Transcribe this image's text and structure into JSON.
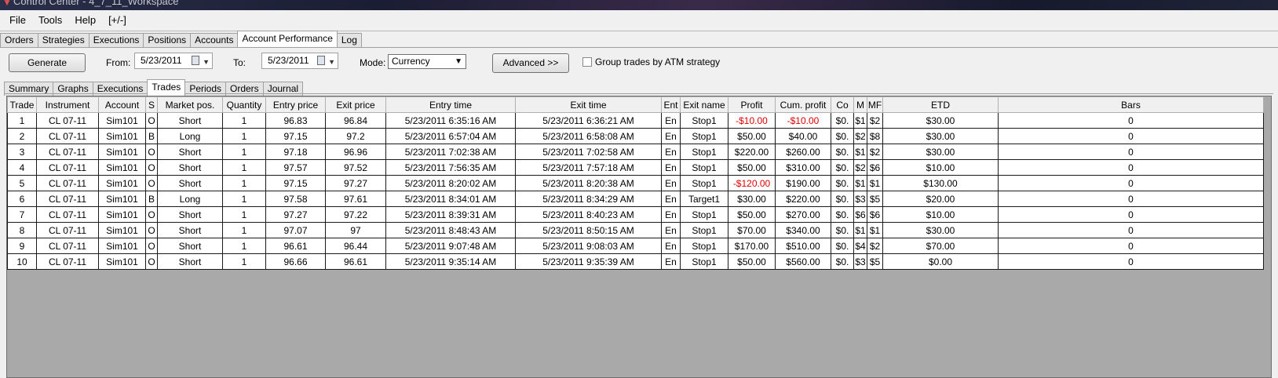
{
  "window": {
    "title": "Control Center - 4_7_11_Workspace"
  },
  "menu": [
    "File",
    "Tools",
    "Help",
    "[+/-]"
  ],
  "top_tabs": [
    {
      "label": "Orders",
      "active": false
    },
    {
      "label": "Strategies",
      "active": false
    },
    {
      "label": "Executions",
      "active": false
    },
    {
      "label": "Positions",
      "active": false
    },
    {
      "label": "Accounts",
      "active": false
    },
    {
      "label": "Account Performance",
      "active": true
    },
    {
      "label": "Log",
      "active": false
    }
  ],
  "toolbar": {
    "generate_label": "Generate",
    "from_label": "From:",
    "from_value": "5/23/2011",
    "to_label": "To:",
    "to_value": "5/23/2011",
    "mode_label": "Mode:",
    "mode_value": "Currency",
    "advanced_label": "Advanced >>",
    "group_label": "Group trades by ATM strategy"
  },
  "inner_tabs": [
    {
      "label": "Summary",
      "active": false
    },
    {
      "label": "Graphs",
      "active": false
    },
    {
      "label": "Executions",
      "active": false
    },
    {
      "label": "Trades",
      "active": true
    },
    {
      "label": "Periods",
      "active": false
    },
    {
      "label": "Orders",
      "active": false
    },
    {
      "label": "Journal",
      "active": false
    }
  ],
  "table": {
    "columns": [
      "Trade",
      "Instrument",
      "Account",
      "S",
      "Market pos.",
      "Quantity",
      "Entry price",
      "Exit price",
      "Entry time",
      "Exit time",
      "Ent",
      "Exit name",
      "Profit",
      "Cum. profit",
      "Co",
      "M",
      "MF",
      "ETD",
      "Bars"
    ],
    "rows": [
      [
        "1",
        "CL 07-11",
        "Sim101",
        "O",
        "Short",
        "1",
        "96.83",
        "96.84",
        "5/23/2011 6:35:16 AM",
        "5/23/2011 6:36:21 AM",
        "En",
        "Stop1",
        "-$10.00",
        "-$10.00",
        "$0.",
        "$1",
        "$2",
        "$30.00",
        "0"
      ],
      [
        "2",
        "CL 07-11",
        "Sim101",
        "B",
        "Long",
        "1",
        "97.15",
        "97.2",
        "5/23/2011 6:57:04 AM",
        "5/23/2011 6:58:08 AM",
        "En",
        "Stop1",
        "$50.00",
        "$40.00",
        "$0.",
        "$2",
        "$8",
        "$30.00",
        "0"
      ],
      [
        "3",
        "CL 07-11",
        "Sim101",
        "O",
        "Short",
        "1",
        "97.18",
        "96.96",
        "5/23/2011 7:02:38 AM",
        "5/23/2011 7:02:58 AM",
        "En",
        "Stop1",
        "$220.00",
        "$260.00",
        "$0.",
        "$1",
        "$2",
        "$30.00",
        "0"
      ],
      [
        "4",
        "CL 07-11",
        "Sim101",
        "O",
        "Short",
        "1",
        "97.57",
        "97.52",
        "5/23/2011 7:56:35 AM",
        "5/23/2011 7:57:18 AM",
        "En",
        "Stop1",
        "$50.00",
        "$310.00",
        "$0.",
        "$2",
        "$6",
        "$10.00",
        "0"
      ],
      [
        "5",
        "CL 07-11",
        "Sim101",
        "O",
        "Short",
        "1",
        "97.15",
        "97.27",
        "5/23/2011 8:20:02 AM",
        "5/23/2011 8:20:38 AM",
        "En",
        "Stop1",
        "-$120.00",
        "$190.00",
        "$0.",
        "$1",
        "$1",
        "$130.00",
        "0"
      ],
      [
        "6",
        "CL 07-11",
        "Sim101",
        "B",
        "Long",
        "1",
        "97.58",
        "97.61",
        "5/23/2011 8:34:01 AM",
        "5/23/2011 8:34:29 AM",
        "En",
        "Target1",
        "$30.00",
        "$220.00",
        "$0.",
        "$3",
        "$5",
        "$20.00",
        "0"
      ],
      [
        "7",
        "CL 07-11",
        "Sim101",
        "O",
        "Short",
        "1",
        "97.27",
        "97.22",
        "5/23/2011 8:39:31 AM",
        "5/23/2011 8:40:23 AM",
        "En",
        "Stop1",
        "$50.00",
        "$270.00",
        "$0.",
        "$6",
        "$6",
        "$10.00",
        "0"
      ],
      [
        "8",
        "CL 07-11",
        "Sim101",
        "O",
        "Short",
        "1",
        "97.07",
        "97",
        "5/23/2011 8:48:43 AM",
        "5/23/2011 8:50:15 AM",
        "En",
        "Stop1",
        "$70.00",
        "$340.00",
        "$0.",
        "$1",
        "$1",
        "$30.00",
        "0"
      ],
      [
        "9",
        "CL 07-11",
        "Sim101",
        "O",
        "Short",
        "1",
        "96.61",
        "96.44",
        "5/23/2011 9:07:48 AM",
        "5/23/2011 9:08:03 AM",
        "En",
        "Stop1",
        "$170.00",
        "$510.00",
        "$0.",
        "$4",
        "$2",
        "$70.00",
        "0"
      ],
      [
        "10",
        "CL 07-11",
        "Sim101",
        "O",
        "Short",
        "1",
        "96.66",
        "96.61",
        "5/23/2011 9:35:14 AM",
        "5/23/2011 9:35:39 AM",
        "En",
        "Stop1",
        "$50.00",
        "$560.00",
        "$0.",
        "$3",
        "$5",
        "$0.00",
        "0"
      ]
    ]
  },
  "colors": {
    "negative": "#e00000"
  }
}
